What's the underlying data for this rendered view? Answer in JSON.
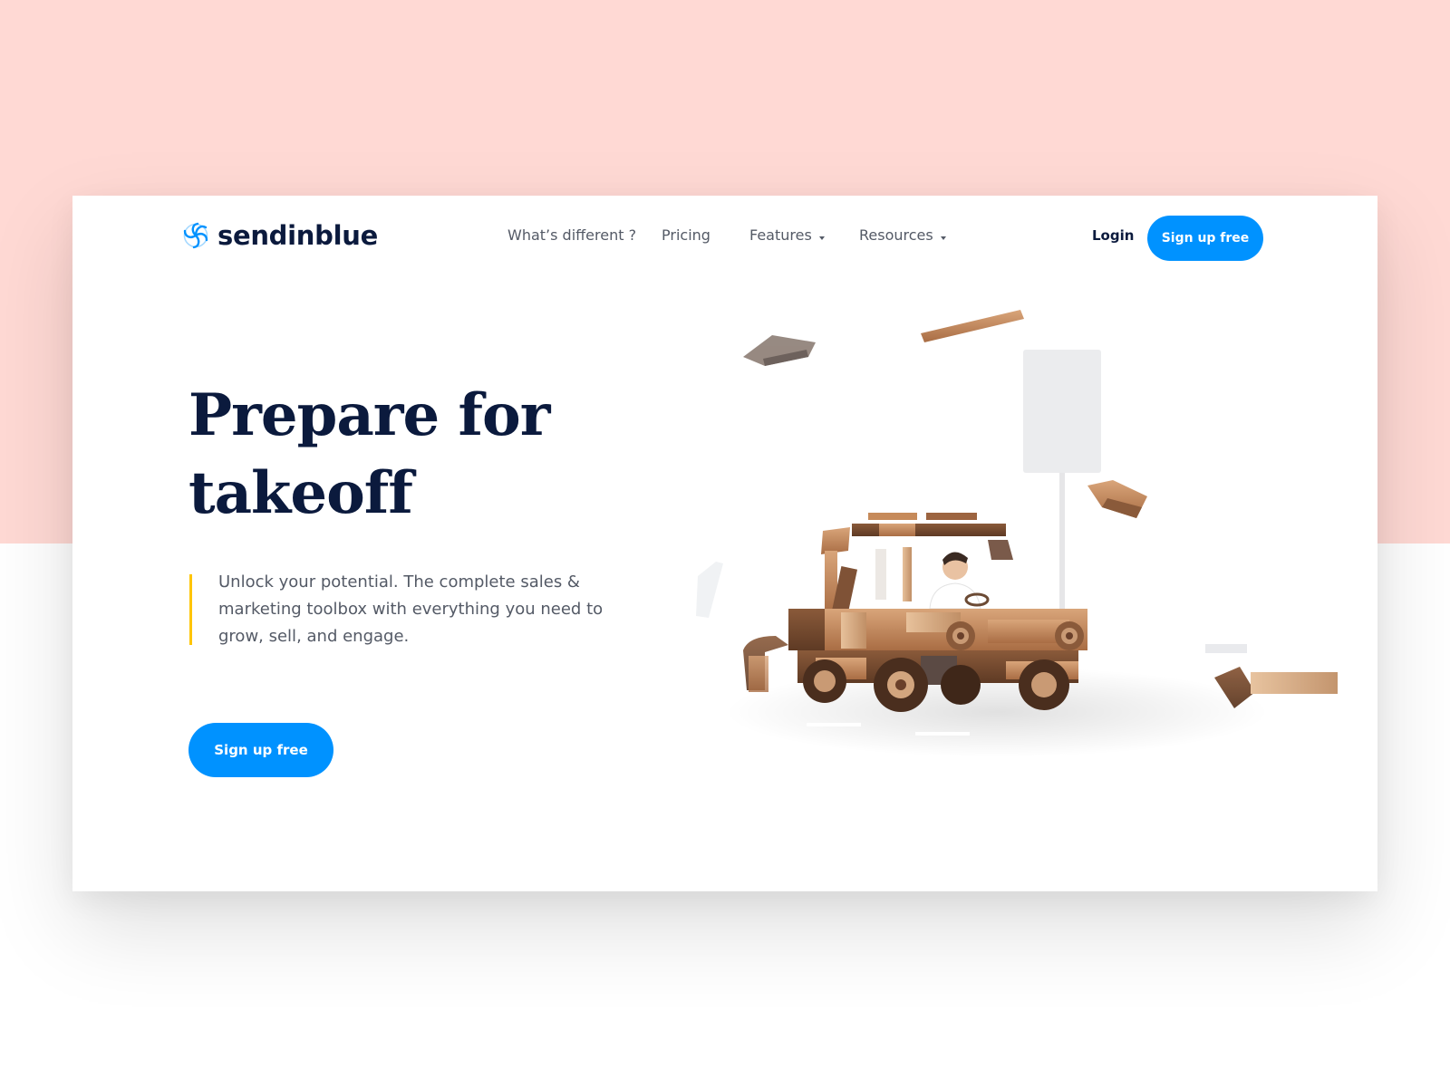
{
  "brand": {
    "name": "sendinblue",
    "accent": "#0092ff",
    "dark": "#0b1a3d",
    "highlight": "#ffc500",
    "background_top": "#ffd9d4"
  },
  "nav": {
    "items": [
      {
        "label": "What’s different ?",
        "dropdown": false
      },
      {
        "label": "Pricing",
        "dropdown": false
      },
      {
        "label": "Features",
        "dropdown": true
      },
      {
        "label": "Resources",
        "dropdown": true
      }
    ],
    "login": "Login",
    "signup": "Sign up free"
  },
  "hero": {
    "title": "Prepare for takeoff",
    "subtitle": "Unlock your potential. The complete sales & marketing toolbox with everything you need to grow, sell, and engage.",
    "cta": "Sign up free"
  },
  "illustration": {
    "subject": "wooden toy car with driver and floating wooden blocks"
  }
}
